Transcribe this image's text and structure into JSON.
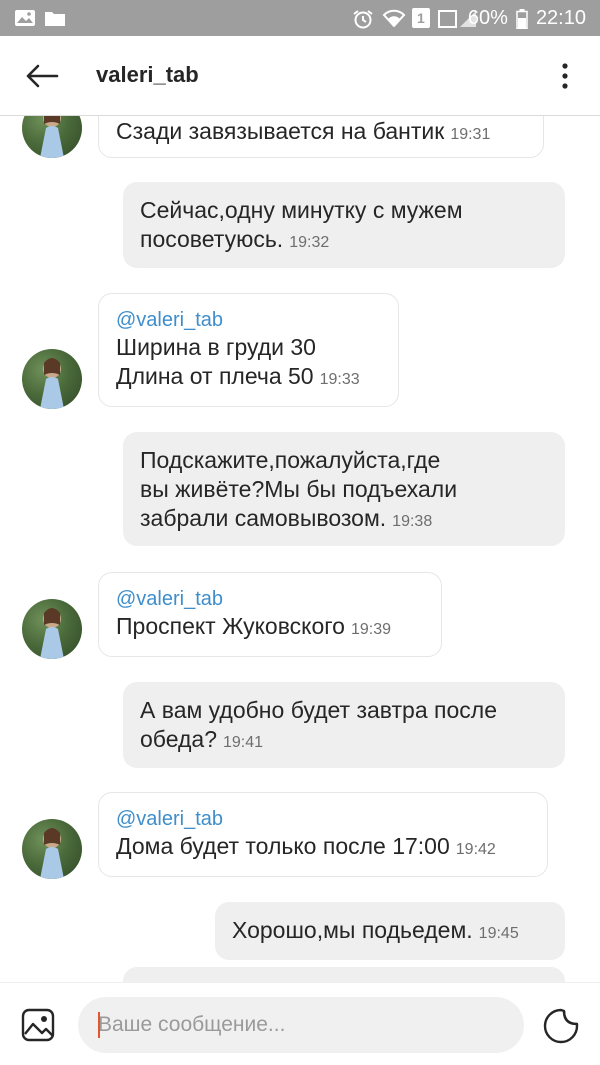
{
  "status_bar": {
    "battery_percent": "60%",
    "time": "22:10",
    "sim_slot": "1"
  },
  "header": {
    "title": "valeri_tab"
  },
  "messages": [
    {
      "dir": "in",
      "text": "Сзади завязывается на бантик",
      "time": "19:31"
    },
    {
      "dir": "out",
      "lines": [
        "Сейчас,одну минутку с мужем",
        "посоветуюсь."
      ],
      "time": "19:32"
    },
    {
      "dir": "in",
      "mention": "@valeri_tab",
      "lines": [
        "Ширина в груди 30",
        "Длина от плеча 50"
      ],
      "time": "19:33"
    },
    {
      "dir": "out",
      "lines": [
        "Подскажите,пожалуйста,где",
        "вы живёте?Мы бы подъехали",
        "забрали самовывозом."
      ],
      "time": "19:38"
    },
    {
      "dir": "in",
      "mention": "@valeri_tab",
      "lines": [
        "Проспект Жуковского"
      ],
      "time": "19:39"
    },
    {
      "dir": "out",
      "lines": [
        "А вам удобно будет завтра после",
        "обеда?"
      ],
      "time": "19:41"
    },
    {
      "dir": "in",
      "mention": "@valeri_tab",
      "lines": [
        "Дома будет только после 17:00"
      ],
      "time": "19:42"
    },
    {
      "dir": "out",
      "lines": [
        "Хорошо,мы подьедем."
      ],
      "time": "19:45"
    }
  ],
  "composer": {
    "placeholder": "Ваше сообщение..."
  }
}
